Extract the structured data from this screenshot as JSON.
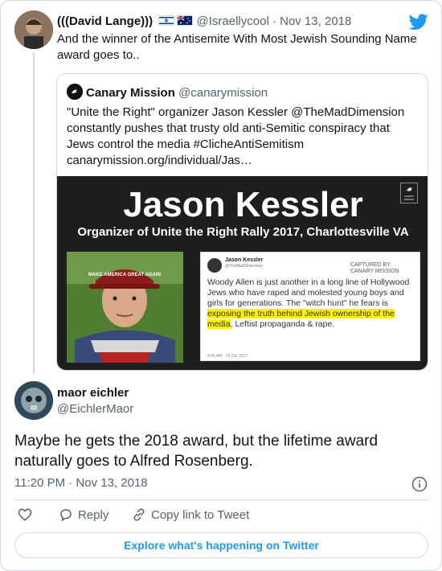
{
  "parent": {
    "name": "(((David Lange)))",
    "handle": "@Israellycool",
    "separator": "·",
    "date": "Nov 13, 2018",
    "text": "And the winner of the Antisemite With Most Jewish Sounding Name award goes to.."
  },
  "quoted": {
    "name": "Canary Mission",
    "handle": "@canarymission",
    "text": "\"Unite the Right\" organizer Jason Kessler @TheMadDimension constantly pushes that trusty old anti-Semitic conspiracy that Jews control the media #ClicheAntiSemitism canarymission.org/individual/Jas…",
    "media": {
      "title": "Jason Kessler",
      "subtitle": "Organizer of Unite the Right Rally 2017, Charlottesville VA",
      "badge": "CANARY MISSION",
      "hat_text": "MAKE AMERICA GREAT AGAIN",
      "shot": {
        "name": "Jason Kessler",
        "handle": "@TheMadDimension",
        "captured": "CAPTURED BY CANARY MISSION",
        "text_before": "Woody Allen is just another in a long line of Hollywood Jews who have raped and molested young boys and girls for generations. The \"witch hunt\" he fears is ",
        "text_highlight": "exposing the truth behind Jewish ownership of the media",
        "text_after": ", Leftist propaganda & rape.",
        "date": "9:45 AM - 15 Oct 2017"
      }
    }
  },
  "reply": {
    "name": "maor eichler",
    "handle": "@EichlerMaor",
    "text": "Maybe he gets the 2018 award, but the lifetime award naturally goes to Alfred Rosenberg.",
    "timestamp": "11:20 PM · Nov 13, 2018"
  },
  "actions": {
    "reply_label": "Reply",
    "copy_label": "Copy link to Tweet"
  },
  "explore_label": "Explore what's happening on Twitter",
  "colors": {
    "accent": "#1d9bf0",
    "muted": "#536471",
    "border": "#cfd9de",
    "highlight": "#fff000"
  },
  "icons": [
    "twitter-bird-icon",
    "israel-flag-icon",
    "australia-flag-icon",
    "info-icon",
    "heart-icon",
    "reply-icon",
    "link-icon"
  ]
}
